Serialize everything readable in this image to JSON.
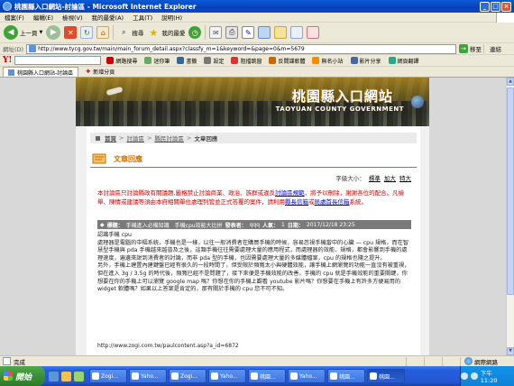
{
  "window": {
    "title": "桃園縣入口網站-討論區 - Microsoft Internet Explorer",
    "minimize": "_",
    "maximize": "□",
    "close": "×"
  },
  "menu": [
    "檔案(F)",
    "編輯(E)",
    "檢視(V)",
    "我的最愛(A)",
    "工具(T)",
    "說明(H)"
  ],
  "toolbar": {
    "back": "上一頁",
    "search": "搜尋",
    "favorites": "我的最愛"
  },
  "address": {
    "label": "網址(D)",
    "url": "http://www.tycg.gov.tw/main/main_forum_detail.aspx?classfy_m=1&keyword=&page=0&m=5679",
    "go": "移至",
    "links": "連結"
  },
  "yahoo_toolbar": {
    "logo": "Y!",
    "buttons": [
      "網路搜尋",
      "迷你筆",
      "書籤",
      "設定",
      "阻擋跳窗",
      "反間諜軟體",
      "無名小站",
      "影片分享",
      "網頁翻譯"
    ]
  },
  "tabs": {
    "current": "桃園縣入口網站-討論區",
    "new_tab": "新增分頁"
  },
  "banner": {
    "title_cn": "桃園縣入口網站",
    "title_en": "TAOYUAN COUNTY GOVERNMENT"
  },
  "breadcrumb": {
    "home": "首頁",
    "forum": "討論區",
    "category": "縣民討論區",
    "current": "文章回應",
    "sep": ">"
  },
  "section_title": "文章回應",
  "font_size": {
    "label": "字級大小：",
    "standard": "標準",
    "large": "加大",
    "xlarge": "特大"
  },
  "notice": {
    "text_before": "本討論區只討論縣政有關議題,嚴格禁止討論商業、政治、族群或違反",
    "link1": "討論區規範",
    "text_mid": "，將予以刪除，謝謝各位的配合。凡檢舉、陳情或建議等須由本府相關單位處理列管並正式答覆的案件，請利用",
    "link2": "縣長信箱",
    "text_or": "或",
    "link3": "局處首長信箱",
    "text_end": "系統。"
  },
  "post": {
    "label_title": "標題：",
    "title": "手機進入必備知識　手機cpu效能大比拼",
    "label_author": "發表者：",
    "author": "qqq",
    "label_hits": "人氣：",
    "hits": "1",
    "label_date": "日期：",
    "date": "2017/12/18 23:25",
    "body": [
      "認識手機 cpu",
      "處理器是電腦的中樞系統，手機也是一樣，以往一般消費者在購買手機的時候，容易忽視手機當中的心臟 — cpu 規格，而在智慧型手機與 pda 手機越來越普及之後，這類手機往往需要處理大量的應用程式，而處理器的效能、規格，都會影響到手機的處理速度，遍邊來說到消費者的討論，而非 pda 型的手機，也因需要處理大量的多媒體檔案，cpu 的規格也隨之提升。",
      "另外，手機上建置內建鍵盤已經有很久的一段時間了，但受限於頻寬太小與硬體效能，讓手機上網瀏覽的功能一直沒有被重視，但在進入 3g / 3.5g 的時代後，頻寬已經不是問題了，接下來便是手機效能的改善，手機的 cpu 就是手機效能的重要關鍵，你想要在你的手機上可以瀏覽 google map 嗎？你想在你的手機上觀看 youtube 影片嗎？你想要在手機上有許多方便易用的 widget 軟體嗎？如果以上答案是肯定的，那有關於手機的 cpu 您不可不知。"
    ],
    "link": "http://www.zogi.com.tw/paulcontent.asp?a_id=6872"
  },
  "status": {
    "text": "完成",
    "zone": "網際網路"
  },
  "taskbar": {
    "start": "開始",
    "items": [
      "Zogi...",
      "Yaho...",
      "Zogi...",
      "Yaho...",
      "桃園...",
      "Yaho...",
      "桃園...",
      "桃園..."
    ],
    "clock": "下午 11:20"
  },
  "colors": {
    "accent": "#d46f00",
    "notice": "#cc0000",
    "titlebar": "#0a5bd8"
  }
}
